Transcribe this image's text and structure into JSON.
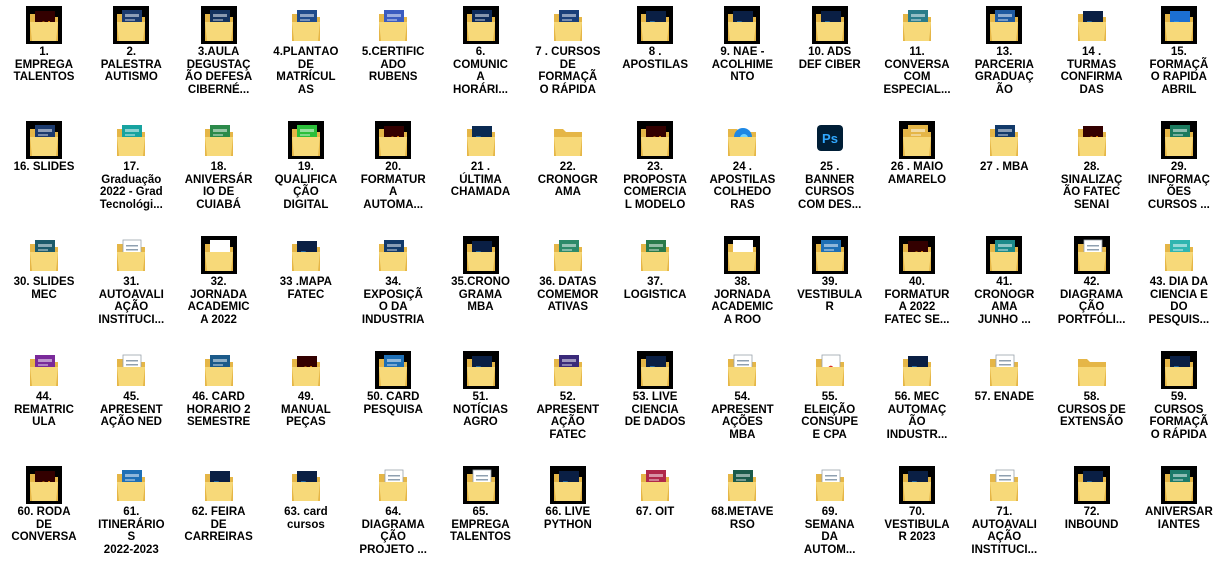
{
  "items": [
    {
      "label": "1.\nEMPREGA\nTALENTOS",
      "kind": "black-ai",
      "accent": "#2b1a08",
      "badge": "Ai"
    },
    {
      "label": "2.\nPALESTRA\nAUTISMO",
      "kind": "black-doc",
      "accent": "#1b3a6e",
      "badge": ""
    },
    {
      "label": "3.AULA\nDEGUSTAÇ\nÃO DEFESA\nCIBERNÉ...",
      "kind": "black-doc",
      "accent": "#14325e",
      "badge": ""
    },
    {
      "label": "4.PLANTÃO\nDE\nMATRÍCUL\nAS",
      "kind": "folder-doc",
      "accent": "#1f4b8c",
      "badge": ""
    },
    {
      "label": "5.CERTIFIC\nADO\nRUBENS",
      "kind": "folder-doc",
      "accent": "#3b5cc0",
      "badge": ""
    },
    {
      "label": "6.\nCOMUNIC\nA\nHORÁRI...",
      "kind": "black-doc",
      "accent": "#0d2a5a",
      "badge": ""
    },
    {
      "label": "7 . CURSOS\nDE\nFORMAÇÃ\nO RÁPIDA",
      "kind": "folder-doc",
      "accent": "#1a3f7a",
      "badge": ""
    },
    {
      "label": "8 .\nAPOSTILAS",
      "kind": "black-ps",
      "accent": "#0a1f44",
      "badge": "Ps"
    },
    {
      "label": "9. NAE -\nACOLHIME\nNTO",
      "kind": "black-ps",
      "accent": "#0a1f44",
      "badge": "Ps"
    },
    {
      "label": "10. ADS\nDEF CIBER",
      "kind": "black-ps",
      "accent": "#0a1f44",
      "badge": "Ps"
    },
    {
      "label": "11.\nCONVERSA\nCOM\nESPECIAL...",
      "kind": "folder-doc",
      "accent": "#2a7c8a",
      "badge": ""
    },
    {
      "label": "13.\nPARCERIA\nGRADUAÇ\nÃO",
      "kind": "black-doc",
      "accent": "#1e5aa0",
      "badge": ""
    },
    {
      "label": "14 .\nTURMAS\nCONFIRMA\nDAS",
      "kind": "folder-ps",
      "accent": "#0a1f44",
      "badge": "Ps"
    },
    {
      "label": "15.\nFORMAÇÃ\nO RAPIDA\nABRIL",
      "kind": "black-ps",
      "accent": "#1c6fd1",
      "badge": "Ps"
    },
    {
      "label": "16. SLIDES",
      "kind": "black-doc",
      "accent": "#1b3a6e",
      "badge": ""
    },
    {
      "label": "17.\nGraduação\n2022 - Grad\nTecnológi...",
      "kind": "folder-doc",
      "accent": "#17a3a0",
      "badge": ""
    },
    {
      "label": "18.\nANIVERSÁR\nIO DE\nCUIABÁ",
      "kind": "folder-doc",
      "accent": "#2c8a4a",
      "badge": ""
    },
    {
      "label": "19.\nQUALIFICA\nÇÃO\nDIGITAL",
      "kind": "black-doc",
      "accent": "#2bbf3a",
      "badge": ""
    },
    {
      "label": "20.\nFORMATUR\nA\nAUTOMA...",
      "kind": "black-ai",
      "accent": "#2b1a08",
      "badge": "Ai"
    },
    {
      "label": "21 .\nÚLTIMA\nCHAMADA",
      "kind": "folder-ps",
      "accent": "#0a2a52",
      "badge": "Ps"
    },
    {
      "label": "22.\nCRONOGR\nAMA",
      "kind": "folder-empty",
      "accent": "#f7d979",
      "badge": ""
    },
    {
      "label": "23.\nPROPOSTA\nCOMERCIA\nL MODELO",
      "kind": "black-ai",
      "accent": "#2b1a08",
      "badge": "Ai"
    },
    {
      "label": "24 .\nAPOSTILAS\nCOLHEDO\nRAS",
      "kind": "folder-edge",
      "accent": "#1e88e5",
      "badge": ""
    },
    {
      "label": "25 .\nBANNER\nCURSOS\nCOM DES...",
      "kind": "plain-ps",
      "accent": "#0a1f44",
      "badge": "Ps"
    },
    {
      "label": "26 . MAIO\nAMARELO",
      "kind": "black-doc",
      "accent": "#e5b647",
      "badge": ""
    },
    {
      "label": "27 . MBA",
      "kind": "folder-doc",
      "accent": "#123a6a",
      "badge": ""
    },
    {
      "label": "28.\nSINALIZAÇ\nÃO FATEC\nSENAI",
      "kind": "folder-ai",
      "accent": "#2b1a08",
      "badge": "Ai"
    },
    {
      "label": "29.\nINFORMAÇ\nÕES\nCURSOS ...",
      "kind": "black-doc",
      "accent": "#1b7a5e",
      "badge": ""
    },
    {
      "label": "30. SLIDES\nMEC",
      "kind": "folder-doc",
      "accent": "#1c5a6a",
      "badge": ""
    },
    {
      "label": "31.\nAUTOAVALI\nAÇÃO\nINSTITUCI...",
      "kind": "folder-paper",
      "accent": "#ffffff",
      "badge": ""
    },
    {
      "label": "32.\nJORNADA\nACADEMIC\nA 2022",
      "kind": "black-doc",
      "accent": "#ffffff",
      "badge": ""
    },
    {
      "label": "33 .MAPA\nFATEC",
      "kind": "folder-ps",
      "accent": "#0a1f44",
      "badge": "Ps"
    },
    {
      "label": "34.\nEXPOSIÇÃ\nO DA\nINDUSTRIA",
      "kind": "folder-doc",
      "accent": "#123a6a",
      "badge": ""
    },
    {
      "label": "35.CRONO\nGRAMA\nMBA",
      "kind": "black-ps",
      "accent": "#0a1f44",
      "badge": "Ps"
    },
    {
      "label": "36. DATAS\nCOMEMOR\nATIVAS",
      "kind": "folder-doc",
      "accent": "#2c8a6a",
      "badge": ""
    },
    {
      "label": "37.\nLOGISTICA",
      "kind": "folder-doc",
      "accent": "#2a7a4a",
      "badge": ""
    },
    {
      "label": "38.\nJORNADA\nACADEMIC\nA ROO",
      "kind": "black-doc",
      "accent": "#ffffff",
      "badge": ""
    },
    {
      "label": "39.\nVESTIBULA\nR",
      "kind": "black-doc",
      "accent": "#1e6fb5",
      "badge": ""
    },
    {
      "label": "40.\nFORMATUR\nA 2022\nFATEC SE...",
      "kind": "black-ai",
      "accent": "#2b1a08",
      "badge": "Ai"
    },
    {
      "label": "41.\nCRONOGR\nAMA\nJUNHO ...",
      "kind": "black-doc",
      "accent": "#1b8a8a",
      "badge": ""
    },
    {
      "label": "42.\nDIAGRAMA\nÇÃO\nPORTFÓLI...",
      "kind": "black-paper",
      "accent": "#ffffff",
      "badge": ""
    },
    {
      "label": "43. DIA DA\nCIENCIA E\nDO\nPESQUIS...",
      "kind": "folder-doc",
      "accent": "#2fb5b0",
      "badge": ""
    },
    {
      "label": "44.\nREMATRIC\nULA",
      "kind": "folder-doc",
      "accent": "#7a2a9a",
      "badge": ""
    },
    {
      "label": "45.\nAPRESENT\nAÇÃO NED",
      "kind": "folder-paper",
      "accent": "#ffffff",
      "badge": ""
    },
    {
      "label": "46. CARD\nHORARIO 2\nSEMESTRE",
      "kind": "folder-doc",
      "accent": "#1b5a8a",
      "badge": ""
    },
    {
      "label": "49.\nMANUAL\nPEÇAS",
      "kind": "folder-ai",
      "accent": "#2b1a08",
      "badge": "Ai"
    },
    {
      "label": "50. CARD\nPESQUISA",
      "kind": "black-doc",
      "accent": "#1e6fb5",
      "badge": ""
    },
    {
      "label": "51.\nNOTÍCIAS\nAGRO",
      "kind": "black-ps",
      "accent": "#0a1f44",
      "badge": "Ps"
    },
    {
      "label": "52.\nAPRESENT\nAÇÃO\nFATEC",
      "kind": "folder-doc",
      "accent": "#3a2a7a",
      "badge": ""
    },
    {
      "label": "53. LIVE\nCIENCIA\nDE DADOS",
      "kind": "black-ps",
      "accent": "#0a1f44",
      "badge": "Ps"
    },
    {
      "label": "54.\nAPRESENT\nAÇÕES\nMBA",
      "kind": "folder-paper",
      "accent": "#d94a4a",
      "badge": ""
    },
    {
      "label": "55.\nELEIÇÃO\nCONSUPE\nE CPA",
      "kind": "folder-pdf",
      "accent": "#d93025",
      "badge": ""
    },
    {
      "label": "56. MEC\nAUTOMAÇ\nÃO\nINDUSTR...",
      "kind": "folder-ps",
      "accent": "#0a1f44",
      "badge": "Ps"
    },
    {
      "label": "57. ENADE",
      "kind": "folder-paper",
      "accent": "#2a7a4a",
      "badge": ""
    },
    {
      "label": "58.\nCURSOS DE\nEXTENSÃO",
      "kind": "folder-empty",
      "accent": "#f7d979",
      "badge": ""
    },
    {
      "label": "59.\nCURSOS\nFORMAÇÃ\nO RÁPIDA",
      "kind": "black-ps",
      "accent": "#0a1f44",
      "badge": "Ps"
    },
    {
      "label": "60. RODA\nDE\nCONVERSA",
      "kind": "black-ai",
      "accent": "#2b1a08",
      "badge": "Ai"
    },
    {
      "label": "61.\nITINERÁRIO\nS\n2022-2023",
      "kind": "folder-doc",
      "accent": "#1e6fb5",
      "badge": ""
    },
    {
      "label": "62. FEIRA\nDE\nCARREIRAS",
      "kind": "folder-ps",
      "accent": "#0a1f44",
      "badge": "Ps"
    },
    {
      "label": "63. card\ncursos",
      "kind": "folder-ps",
      "accent": "#0a1f44",
      "badge": "Ps"
    },
    {
      "label": "64.\nDIAGRAMA\nÇÃO\nPROJETO ...",
      "kind": "folder-paper",
      "accent": "#ffffff",
      "badge": ""
    },
    {
      "label": "65.\nEMPREGA\nTALENTOS",
      "kind": "black-paper",
      "accent": "#ffffff",
      "badge": ""
    },
    {
      "label": "66. LIVE\nPYTHON",
      "kind": "black-ps",
      "accent": "#0a1f44",
      "badge": "Ps"
    },
    {
      "label": "67. OIT",
      "kind": "folder-doc",
      "accent": "#b0284a",
      "badge": ""
    },
    {
      "label": "68.METAVE\nRSO",
      "kind": "folder-doc",
      "accent": "#1b5a4a",
      "badge": ""
    },
    {
      "label": "69.\nSEMANA\nDA\nAUTOM...",
      "kind": "folder-paper",
      "accent": "#ffffff",
      "badge": ""
    },
    {
      "label": "70.\nVESTIBULA\nR 2023",
      "kind": "black-ps",
      "accent": "#0a1f44",
      "badge": "Ps"
    },
    {
      "label": "71.\nAUTOAVALI\nAÇÃO\nINSTITUCI...",
      "kind": "folder-paper",
      "accent": "#ffffff",
      "badge": ""
    },
    {
      "label": "72.\nINBOUND",
      "kind": "black-ps",
      "accent": "#0a1f44",
      "badge": "Ps"
    },
    {
      "label": "ANIVERSAR\nIANTES",
      "kind": "black-doc",
      "accent": "#1b7a6a",
      "badge": ""
    }
  ]
}
